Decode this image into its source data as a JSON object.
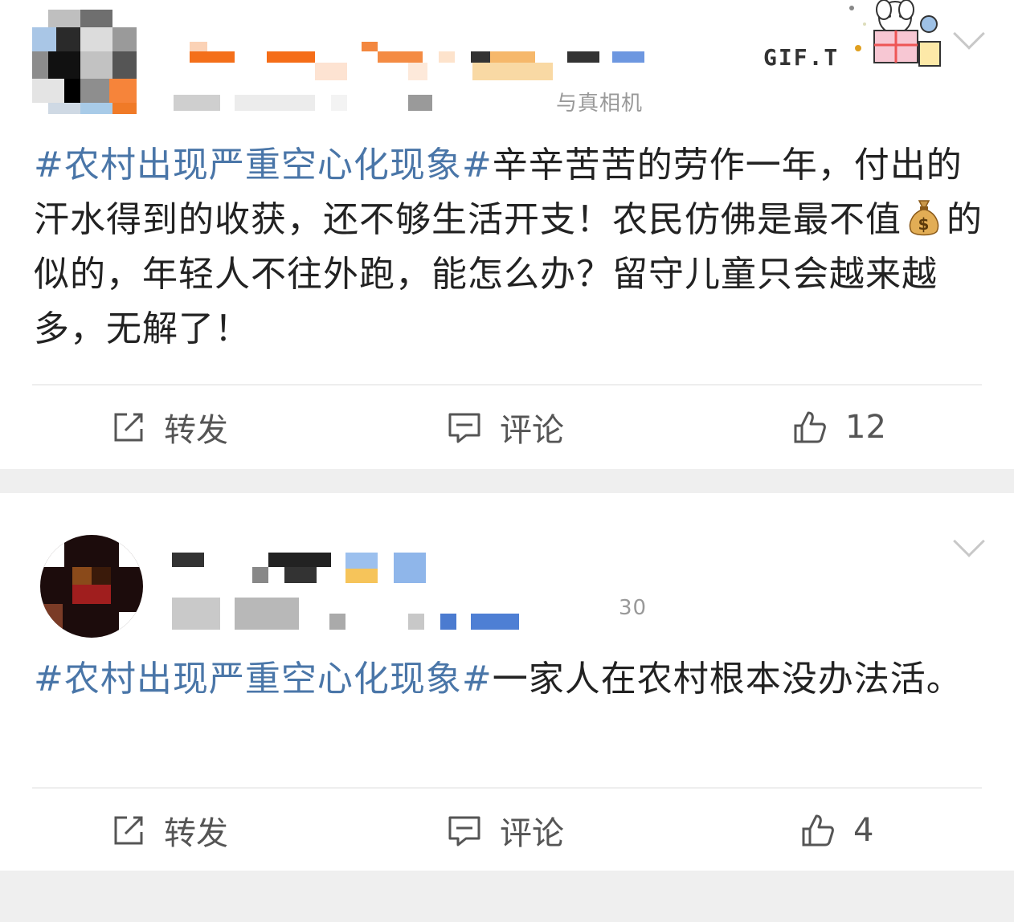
{
  "posts": [
    {
      "source_tail": "与真相机",
      "hashtag": "#农村出现严重空心化现象#",
      "text": "辛辛苦苦的劳作一年，付出的汗水得到的收获，还不够生活开支！农民仿佛是最不值",
      "text_after_emoji": "的似的，年轻人不往外跑，能怎么办？留守儿童只会越来越多，无解了！",
      "emoji": "money-bag-emoji",
      "gift_label": "GIF.T",
      "repost_label": "转发",
      "comment_label": "评论",
      "like_count": "12"
    },
    {
      "source_tail": "30",
      "hashtag": "#农村出现严重空心化现象#",
      "text": "一家人在农村根本没办法活。",
      "repost_label": "转发",
      "comment_label": "评论",
      "like_count": "4"
    }
  ],
  "colors": {
    "hashtag": "#4a76a8",
    "text": "#222222",
    "action_text": "#555555",
    "separator_bg": "#efefef"
  }
}
